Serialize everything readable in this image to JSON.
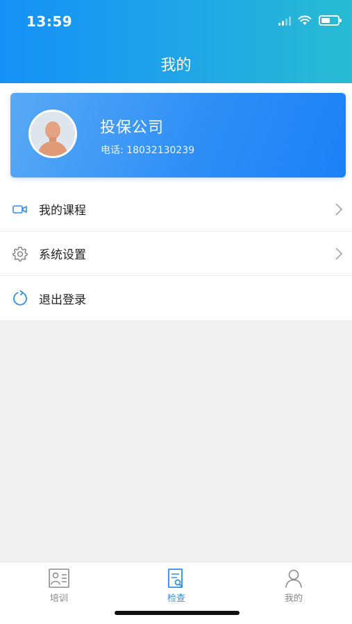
{
  "status_bar": {
    "time": "13:59"
  },
  "header": {
    "title": "我的"
  },
  "profile": {
    "company_name": "投保公司",
    "phone": "电话: 18032130239"
  },
  "menu": [
    {
      "label": "我的课程",
      "icon": "video-camera-icon"
    },
    {
      "label": "系统设置",
      "icon": "gear-icon"
    },
    {
      "label": "退出登录",
      "icon": "refresh-logout-icon"
    }
  ],
  "tabbar": {
    "items": [
      {
        "label": "培训",
        "icon": "training-card-icon"
      },
      {
        "label": "检查",
        "icon": "document-search-icon",
        "active": true
      },
      {
        "label": "我的",
        "icon": "person-icon"
      }
    ]
  },
  "colors": {
    "accent": "#2b8ff0",
    "header_gradient_start": "#1591f6",
    "header_gradient_end": "#27bcd2",
    "card_blue": "#2f8ff6"
  }
}
